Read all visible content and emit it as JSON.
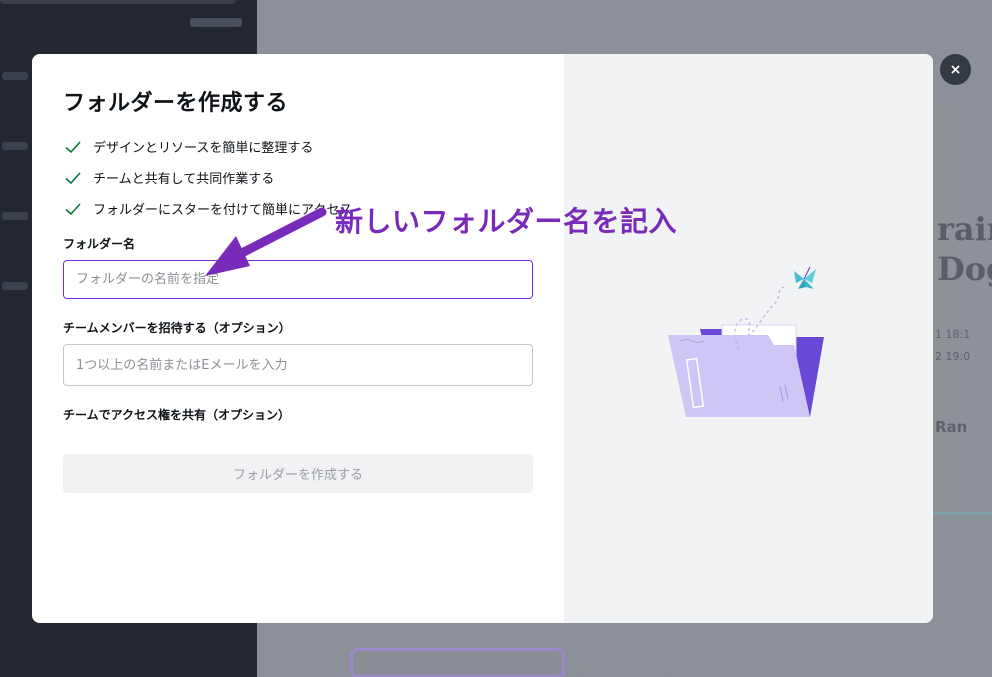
{
  "dialog": {
    "title": "フォルダーを作成する",
    "features": [
      "デザインとリソースを簡単に整理する",
      "チームと共有して共同作業する",
      "フォルダーにスターを付けて簡単にアクセス"
    ],
    "folder_name_label": "フォルダー名",
    "folder_name_placeholder": "フォルダーの名前を指定",
    "members_label": "チームメンバーを招待する（オプション）",
    "members_placeholder": "1つ以上の名前またはEメールを入力",
    "share_label": "チームでアクセス権を共有（オプション）",
    "create_button": "フォルダーを作成する",
    "close_symbol": "×"
  },
  "annotation": {
    "text": "新しいフォルダー名を記入"
  },
  "background": {
    "card_lines": [
      "rain",
      "Dog"
    ],
    "card_small": [
      "1 18:1",
      "2 19:0",
      "Ran"
    ]
  },
  "colors": {
    "accent": "#7d2ae8",
    "annotation": "#7a2ab8",
    "check": "#0a7a36",
    "overlay": "#888d95"
  },
  "icons": {
    "close": "close-icon",
    "check": "check-icon",
    "illustration": "folder-illustration"
  }
}
